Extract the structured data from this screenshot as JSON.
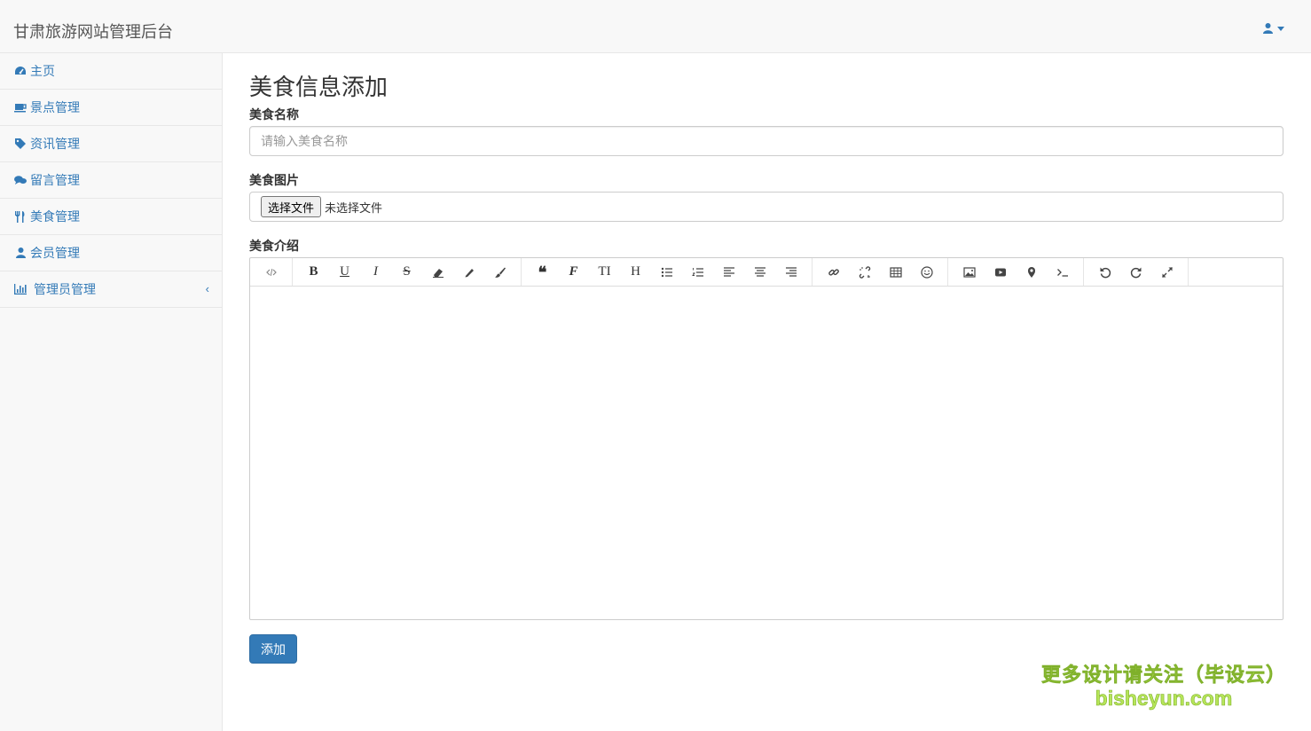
{
  "navbar": {
    "brand": "甘肃旅游网站管理后台",
    "user_icon": "user-icon"
  },
  "sidebar": {
    "items": [
      {
        "label": "主页",
        "icon": "dashboard-icon"
      },
      {
        "label": "景点管理",
        "icon": "coffee-cup-icon"
      },
      {
        "label": "资讯管理",
        "icon": "tag-icon"
      },
      {
        "label": "留言管理",
        "icon": "comments-icon"
      },
      {
        "label": "美食管理",
        "icon": "cutlery-icon"
      },
      {
        "label": "会员管理",
        "icon": "user-icon"
      },
      {
        "label": "管理员管理",
        "icon": "bar-chart-icon",
        "expand_glyph": "‹"
      }
    ]
  },
  "form": {
    "title": "美食信息添加",
    "name_label": "美食名称",
    "name_placeholder": "请输入美食名称",
    "image_label": "美食图片",
    "file_button": "选择文件",
    "file_status": "未选择文件",
    "intro_label": "美食介绍",
    "submit_label": "添加"
  },
  "editor_toolbar": [
    [
      "code-view"
    ],
    [
      "bold",
      "underline",
      "italic",
      "strikethrough",
      "eraser",
      "pencil",
      "brush"
    ],
    [
      "quote",
      "font",
      "font-size",
      "heading",
      "unordered-list",
      "ordered-list",
      "align-left",
      "align-center",
      "align-right"
    ],
    [
      "link",
      "unlink",
      "table",
      "emoji"
    ],
    [
      "image",
      "video",
      "map-marker",
      "terminal"
    ],
    [
      "undo",
      "redo",
      "fullscreen"
    ]
  ],
  "watermark": {
    "line1": "更多设计请关注（毕设云）",
    "line2": "bisheyun.com"
  },
  "colors": {
    "accent": "#337ab7",
    "sidebar_bg": "#f8f8f8",
    "border": "#e7e7e7"
  }
}
